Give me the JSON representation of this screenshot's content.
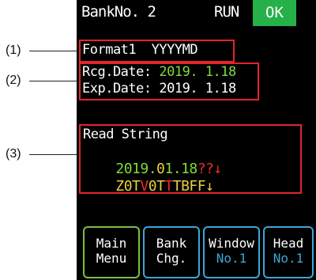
{
  "callouts": [
    "(1)",
    "(2)",
    "(3)"
  ],
  "header": {
    "bank": "BankNo. 2",
    "run": "RUN",
    "ok": "OK"
  },
  "format": {
    "label": "Format1",
    "value": "YYYYMD"
  },
  "dates": [
    {
      "label": "Rcg.Date:",
      "value": "2019. 1.18"
    },
    {
      "label": "Exp.Date:",
      "value": "2019. 1.18"
    }
  ],
  "read": {
    "title": "Read String",
    "line1": [
      {
        "t": "2019.",
        "c": "green"
      },
      {
        "t": "0",
        "c": "yellow"
      },
      {
        "t": "1.18",
        "c": "green"
      },
      {
        "t": "??↓",
        "c": "red"
      }
    ],
    "line2": [
      {
        "t": "Z0T",
        "c": "yellow"
      },
      {
        "t": "V",
        "c": "red"
      },
      {
        "t": "0T",
        "c": "yellow"
      },
      {
        "t": "T",
        "c": "red"
      },
      {
        "t": "TBFF↓",
        "c": "yellow"
      }
    ]
  },
  "buttons": [
    {
      "l1": "Main",
      "l2": "Menu"
    },
    {
      "l1": "Bank",
      "l2": "Chg."
    },
    {
      "l1": "Window",
      "l2": "No.1"
    },
    {
      "l1": "Head",
      "l2": "No.1"
    }
  ],
  "colors": {
    "accent_green": "#25b04a",
    "frame_red": "#e3242b",
    "button_blue": "#3aa7d8",
    "button_green": "#7bc043"
  }
}
